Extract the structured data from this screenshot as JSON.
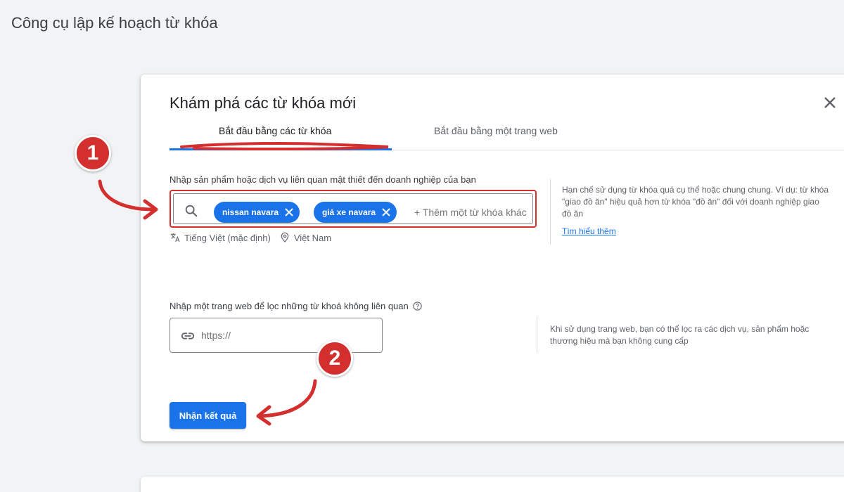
{
  "page_title": "Công cụ lập kế hoạch từ khóa",
  "dialog": {
    "title": "Khám phá các từ khóa mới",
    "tabs": [
      {
        "label": "Bắt đầu bằng các từ khóa"
      },
      {
        "label": "Bắt đầu bằng một trang web"
      }
    ],
    "keywords_section": {
      "label": "Nhập sản phẩm hoặc dịch vụ liên quan mật thiết đến doanh nghiệp của bạn",
      "chips": [
        "nissan navara",
        "giá xe navara"
      ],
      "add_placeholder": "+ Thêm một từ khóa khác",
      "language": "Tiếng Việt (mặc định)",
      "location": "Việt Nam",
      "hint": "Hạn chế sử dụng từ khóa quá cụ thể hoặc chung chung. Ví dụ: từ khóa \"giao đồ ăn\" hiệu quả hơn từ khóa \"đồ ăn\" đối với doanh nghiệp giao đồ ăn",
      "learn_more": "Tìm hiểu thêm"
    },
    "website_section": {
      "label": "Nhập một trang web để lọc những từ khoá không liên quan",
      "placeholder": "https://",
      "hint": "Khi sử dụng trang web, bạn có thể lọc ra các dịch vụ, sản phẩm hoặc thương hiệu mà bạn không cung cấp"
    },
    "submit_label": "Nhận kết quả"
  },
  "annotations": {
    "badge_1": "1",
    "badge_2": "2"
  },
  "colors": {
    "accent": "#1a73e8",
    "annotation_red": "#d32f2f",
    "background": "#f1f3f4"
  }
}
